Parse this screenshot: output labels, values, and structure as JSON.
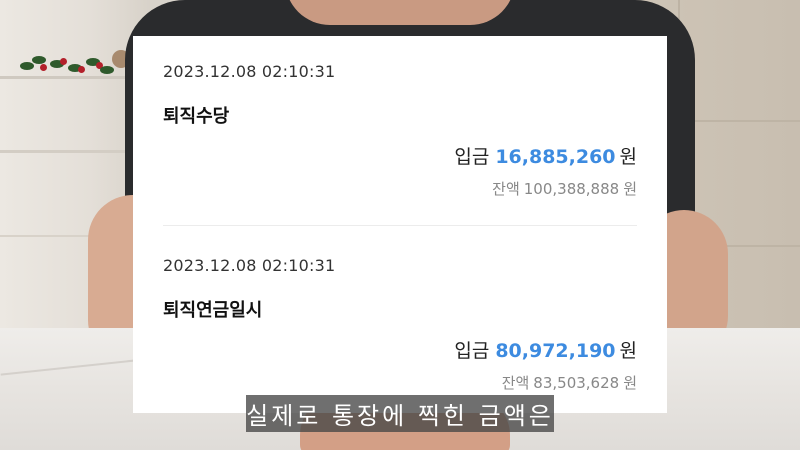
{
  "entries": [
    {
      "datetime": "2023.12.08 02:10:31",
      "title": "퇴직수당",
      "amount_label": "입금",
      "amount": "16,885,260",
      "amount_unit": "원",
      "balance_label": "잔액",
      "balance": "100,388,888",
      "balance_unit": "원"
    },
    {
      "datetime": "2023.12.08 02:10:31",
      "title": "퇴직연금일시",
      "amount_label": "입금",
      "amount": "80,972,190",
      "amount_unit": "원",
      "balance_label": "잔액",
      "balance": "83,503,628",
      "balance_unit": "원"
    }
  ],
  "subtitle": "실제로 통장에 찍힌 금액은",
  "colors": {
    "amount": "#3d8be0",
    "shirt": "#2a2b2d",
    "card": "#ffffff"
  }
}
